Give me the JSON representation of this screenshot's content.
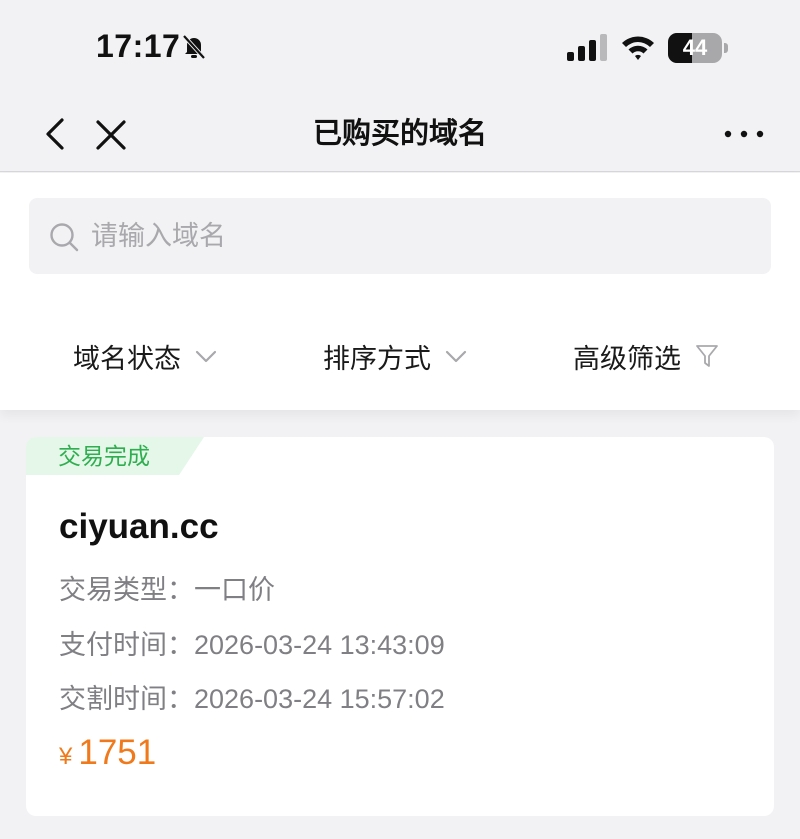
{
  "status_bar": {
    "time": "17:17",
    "battery_level": "44",
    "battery_fraction": 0.44,
    "icons": [
      "bell-off-icon",
      "cellular-signal-icon",
      "wifi-icon",
      "battery-icon"
    ]
  },
  "nav": {
    "title": "已购买的域名",
    "icons": [
      "chevron-left-icon",
      "close-icon",
      "more-icon"
    ]
  },
  "search": {
    "placeholder": "请输入域名",
    "value": ""
  },
  "filters": [
    {
      "label": "域名状态",
      "icon": "chevron-down-icon"
    },
    {
      "label": "排序方式",
      "icon": "chevron-down-icon"
    },
    {
      "label": "高级筛选",
      "icon": "filter-icon"
    }
  ],
  "order": {
    "status": "交易完成",
    "domain": "ciyuan.cc",
    "rows": [
      {
        "label": "交易类型：",
        "value": "一口价"
      },
      {
        "label": "支付时间：",
        "value": "2026-03-24 13:43:09"
      },
      {
        "label": "交割时间：",
        "value": "2026-03-24 15:57:02"
      }
    ],
    "price_symbol": "¥",
    "price": "1751"
  },
  "colors": {
    "background": "#f2f2f4",
    "status_green": "#2fae4f",
    "status_tag_bg": "#e4f7e8",
    "price_orange": "#f07a1b",
    "muted_text": "#808084"
  }
}
